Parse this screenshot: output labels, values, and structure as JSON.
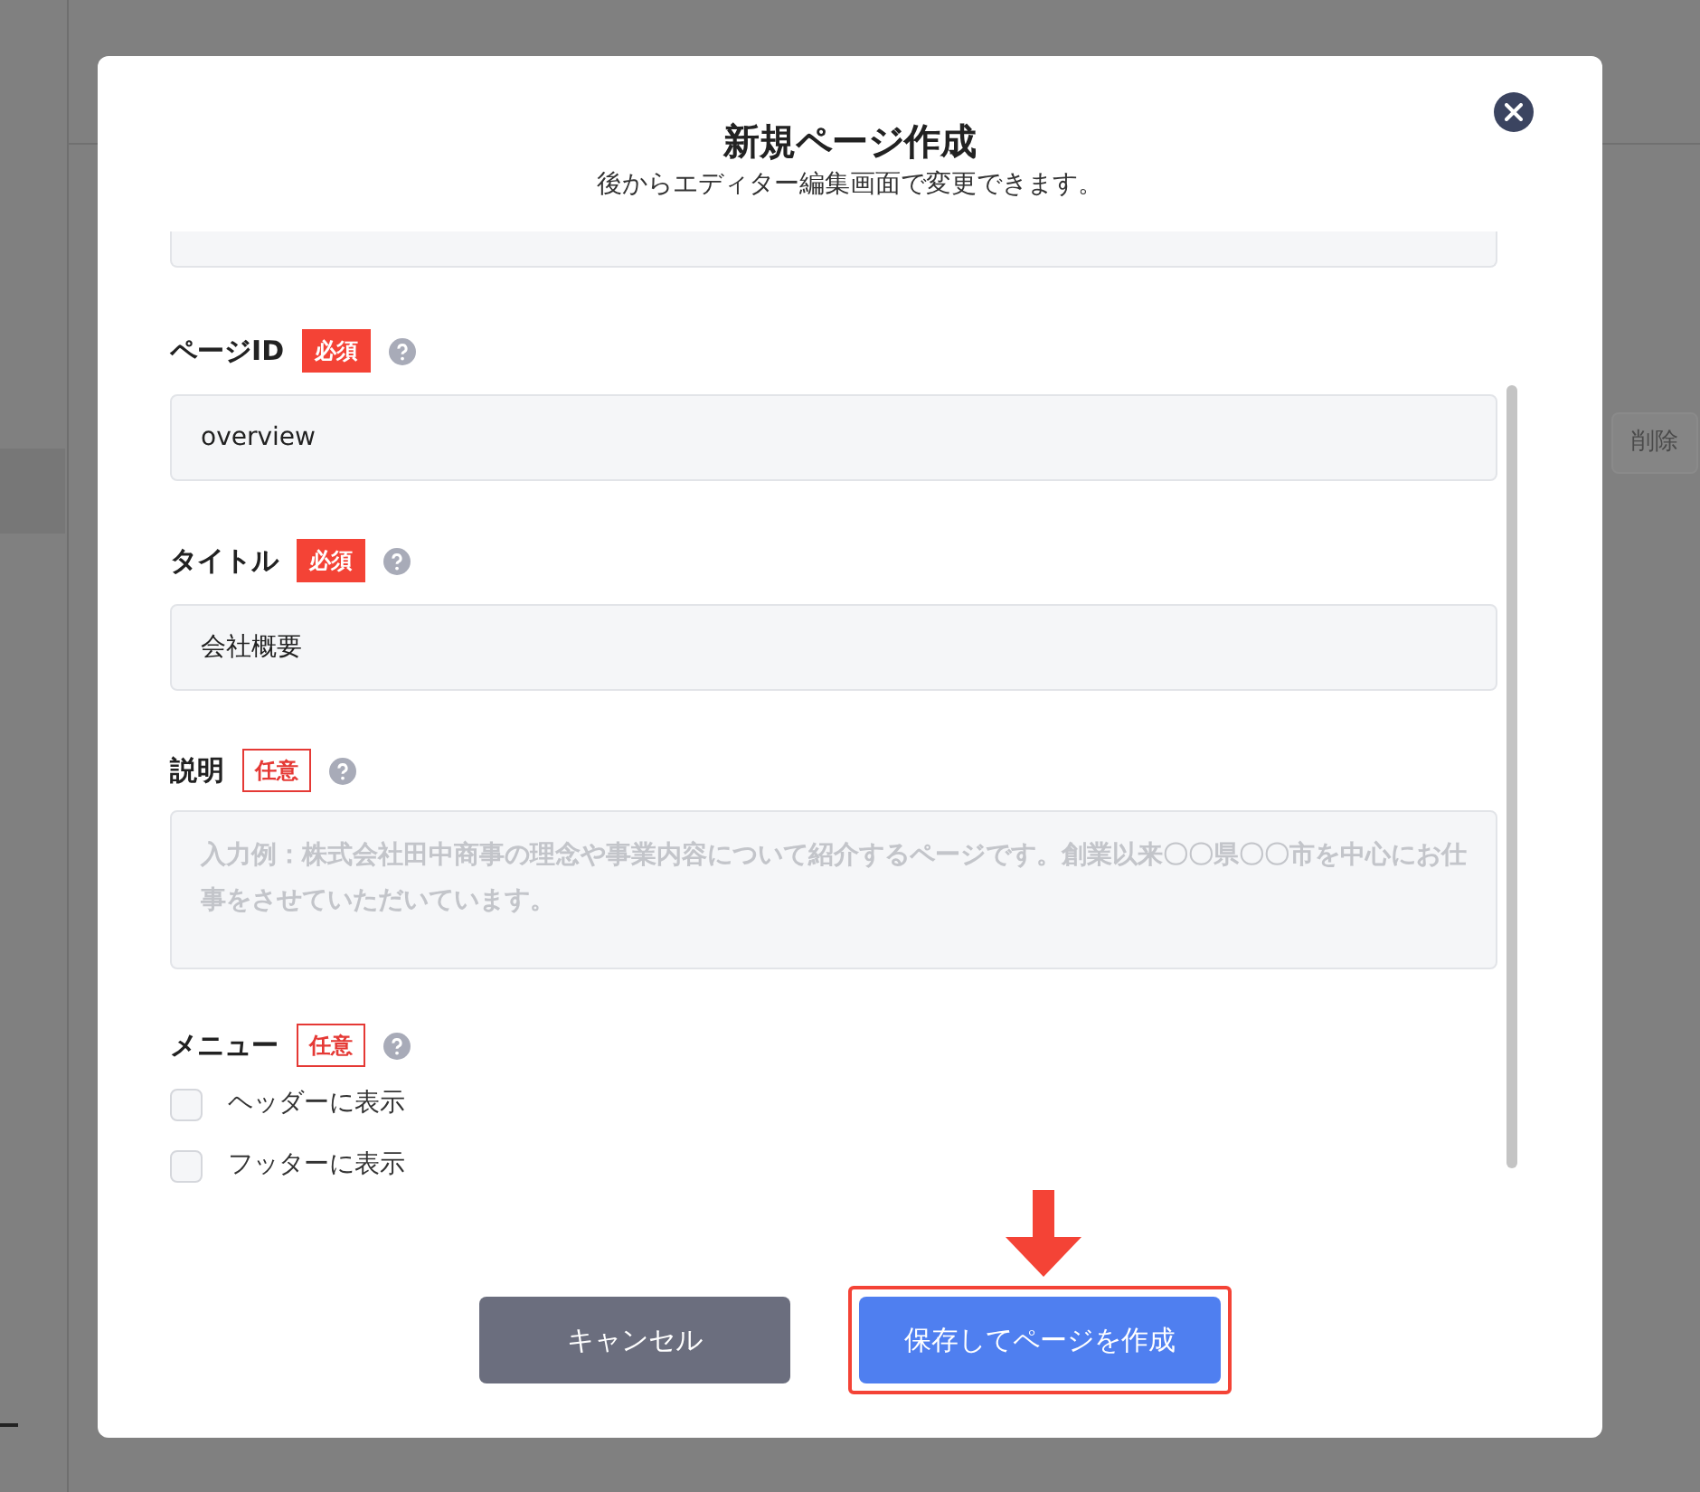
{
  "background": {
    "delete_button": "削除"
  },
  "dialog": {
    "title": "新規ページ作成",
    "subtitle": "後からエディター編集画面で変更できます。",
    "fields": [
      {
        "kind": "input",
        "label": "ページID",
        "badge": {
          "text": "必須",
          "kind": "required"
        },
        "value": "overview"
      },
      {
        "kind": "input",
        "label": "タイトル",
        "badge": {
          "text": "必須",
          "kind": "required"
        },
        "value": "会社概要"
      },
      {
        "kind": "textarea",
        "label": "説明",
        "badge": {
          "text": "任意",
          "kind": "optional"
        },
        "placeholder": "入力例：株式会社田中商事の理念や事業内容について紹介するページです。創業以来〇〇県〇〇市を中心にお仕事をさせていただいています。"
      }
    ],
    "menu": {
      "label": "メニュー",
      "badge": {
        "text": "任意",
        "kind": "optional"
      },
      "options": [
        {
          "label": "ヘッダーに表示",
          "checked": false
        },
        {
          "label": "フッターに表示",
          "checked": false
        }
      ]
    },
    "buttons": [
      {
        "kind": "cancel",
        "label": "キャンセル",
        "highlighted": false
      },
      {
        "kind": "primary",
        "label": "保存してページを作成",
        "highlighted": true
      }
    ]
  }
}
